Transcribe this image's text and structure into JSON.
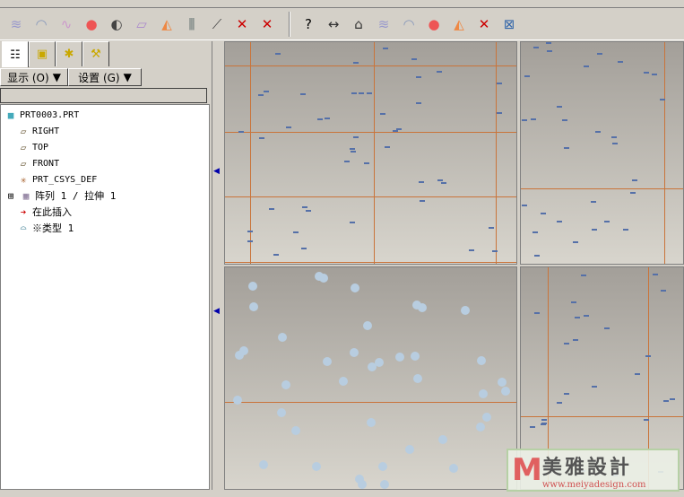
{
  "toolbar": {
    "icons": [
      "curvature-icon",
      "section-icon",
      "offset-icon",
      "shade-icon",
      "reflection-icon",
      "draft-icon",
      "slope-icon",
      "dihedral-icon",
      "deviation-icon",
      "delete-curvature-icon",
      "delete-section-icon",
      "help-icon",
      "measure-icon",
      "area-icon",
      "curve-analysis-icon",
      "surface-analysis-icon",
      "shade-analysis-icon",
      "slope-analysis-icon",
      "delete-analysis-icon",
      "hide-analysis-icon"
    ]
  },
  "left_panel": {
    "tabs": [
      "model-tree",
      "layers",
      "favorites",
      "connections"
    ],
    "show_label": "显示 (O)",
    "settings_label": "设置 (G)",
    "tree": [
      {
        "label": "PRT0003.PRT",
        "icon": "part-icon"
      },
      {
        "label": "RIGHT",
        "icon": "datum-plane-icon"
      },
      {
        "label": "TOP",
        "icon": "datum-plane-icon"
      },
      {
        "label": "FRONT",
        "icon": "datum-plane-icon"
      },
      {
        "label": "PRT_CSYS_DEF",
        "icon": "csys-icon"
      },
      {
        "label": "阵列 1 / 拉伸 1",
        "icon": "pattern-icon"
      },
      {
        "label": "在此插入",
        "icon": "insert-here-icon"
      },
      {
        "label": "※类型 1",
        "icon": "feature-icon"
      }
    ]
  },
  "watermark": {
    "brand": "美雅設計",
    "url": "www.meiyadesign.com"
  },
  "colors": {
    "grid": "#c9743a",
    "dot": "#b8cde0"
  }
}
